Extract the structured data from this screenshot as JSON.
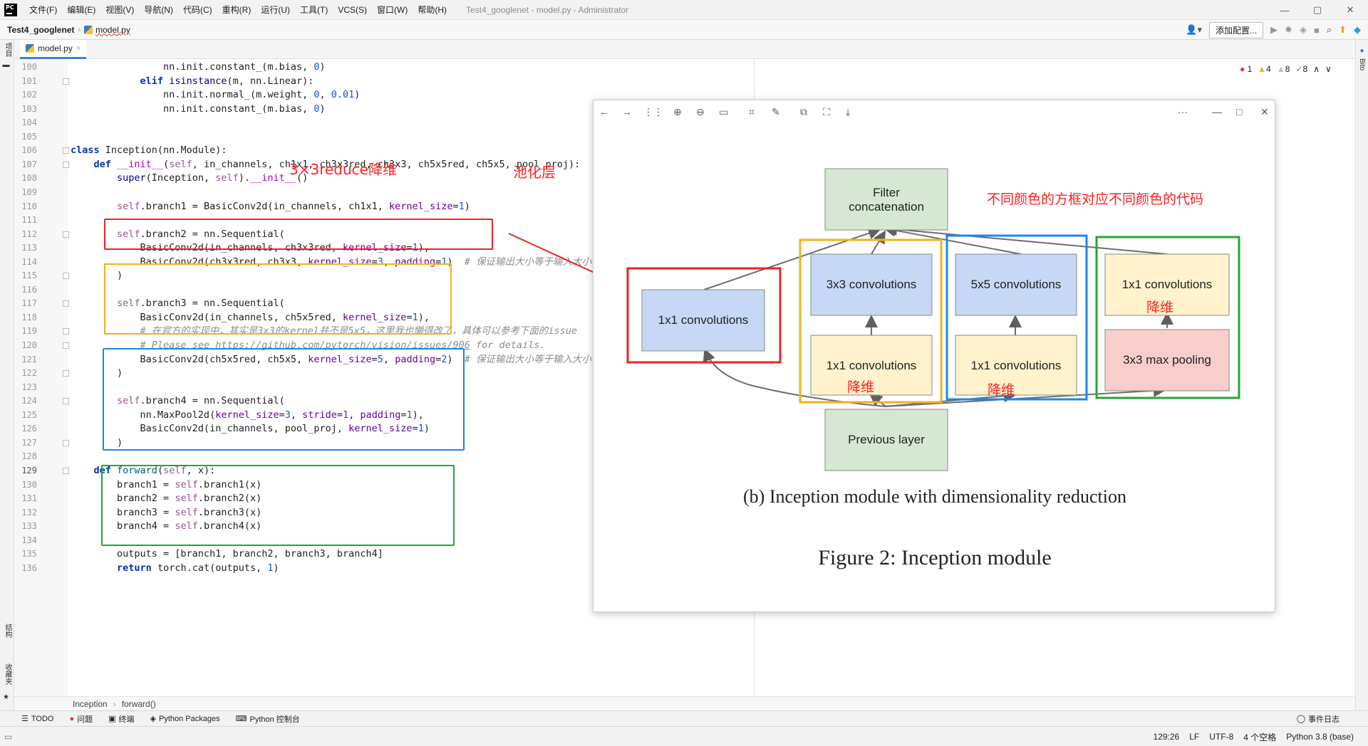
{
  "window": {
    "title": "Test4_googlenet - model.py - Administrator",
    "minimize": "—",
    "maximize": "▢",
    "close": "✕"
  },
  "menu": [
    "文件(F)",
    "编辑(E)",
    "视图(V)",
    "导航(N)",
    "代码(C)",
    "重构(R)",
    "运行(U)",
    "工具(T)",
    "VCS(S)",
    "窗口(W)",
    "帮助(H)"
  ],
  "nav": {
    "project": "Test4_googlenet",
    "file": "model.py",
    "add_config": "添加配置..."
  },
  "left_strip": {
    "project": "项目",
    "structure": "结构",
    "favorites": "收藏夹"
  },
  "right_strip": {
    "bito": "Bito"
  },
  "tab": {
    "label": "model.py",
    "close": "×"
  },
  "inspections": {
    "errors": "1",
    "warnings": "4",
    "weak": "8",
    "ok": "8"
  },
  "code": [
    {
      "n": "100",
      "segs": [
        [
          "t",
          "                nn.init.constant_(m.bias, "
        ],
        [
          "num",
          "0"
        ],
        [
          "t",
          ")"
        ]
      ]
    },
    {
      "n": "101",
      "segs": [
        [
          "t",
          "            "
        ],
        [
          "kw",
          "elif "
        ],
        [
          "bi",
          "isinstance"
        ],
        [
          "t",
          "(m, nn.Linear):"
        ]
      ]
    },
    {
      "n": "102",
      "segs": [
        [
          "t",
          "                nn.init.normal_(m.weight, "
        ],
        [
          "num",
          "0"
        ],
        [
          "t",
          ", "
        ],
        [
          "num",
          "0.01"
        ],
        [
          "t",
          ")"
        ]
      ]
    },
    {
      "n": "103",
      "segs": [
        [
          "t",
          "                nn.init.constant_(m.bias, "
        ],
        [
          "num",
          "0"
        ],
        [
          "t",
          ")"
        ]
      ]
    },
    {
      "n": "104",
      "segs": []
    },
    {
      "n": "105",
      "segs": []
    },
    {
      "n": "106",
      "segs": [
        [
          "kw",
          "class "
        ],
        [
          "t",
          "Inception(nn.Module):"
        ]
      ]
    },
    {
      "n": "107",
      "segs": [
        [
          "t",
          "    "
        ],
        [
          "kw",
          "def "
        ],
        [
          "fn",
          "__init__"
        ],
        [
          "t",
          "("
        ],
        [
          "self",
          "self"
        ],
        [
          "t",
          ", in_channels, ch1x1, ch3x3red, ch3x3, ch5x5red, ch5x5, pool_proj):"
        ]
      ]
    },
    {
      "n": "108",
      "segs": [
        [
          "t",
          "        "
        ],
        [
          "bi",
          "super"
        ],
        [
          "t",
          "(Inception, "
        ],
        [
          "self",
          "self"
        ],
        [
          "t",
          ")."
        ],
        [
          "fn",
          "__init__"
        ],
        [
          "t",
          "()"
        ]
      ]
    },
    {
      "n": "109",
      "segs": []
    },
    {
      "n": "110",
      "segs": [
        [
          "t",
          "        "
        ],
        [
          "self",
          "self"
        ],
        [
          "t",
          ".branch1 = BasicConv2d(in_channels, ch1x1, "
        ],
        [
          "kwa",
          "kernel_size"
        ],
        [
          "t",
          "="
        ],
        [
          "num",
          "1"
        ],
        [
          "t",
          ")"
        ]
      ]
    },
    {
      "n": "111",
      "segs": []
    },
    {
      "n": "112",
      "segs": [
        [
          "t",
          "        "
        ],
        [
          "self",
          "self"
        ],
        [
          "t",
          ".branch2 = nn.Sequential("
        ]
      ]
    },
    {
      "n": "113",
      "segs": [
        [
          "t",
          "            BasicConv2d(in_channels, ch3x3red, "
        ],
        [
          "kwa",
          "kernel_size"
        ],
        [
          "t",
          "="
        ],
        [
          "num",
          "1"
        ],
        [
          "t",
          "),"
        ]
      ]
    },
    {
      "n": "114",
      "segs": [
        [
          "t",
          "            BasicConv2d(ch3x3red, ch3x3, "
        ],
        [
          "kwa",
          "kernel_size"
        ],
        [
          "t",
          "="
        ],
        [
          "num",
          "3"
        ],
        [
          "t",
          ", "
        ],
        [
          "kwa",
          "padding"
        ],
        [
          "t",
          "="
        ],
        [
          "num",
          "1"
        ],
        [
          "t",
          ")  "
        ],
        [
          "cm",
          "# 保证输出大小等于输入大小"
        ]
      ]
    },
    {
      "n": "115",
      "segs": [
        [
          "t",
          "        )"
        ]
      ]
    },
    {
      "n": "116",
      "segs": []
    },
    {
      "n": "117",
      "segs": [
        [
          "t",
          "        "
        ],
        [
          "self",
          "self"
        ],
        [
          "t",
          ".branch3 = nn.Sequential("
        ]
      ]
    },
    {
      "n": "118",
      "segs": [
        [
          "t",
          "            BasicConv2d(in_channels, ch5x5red, "
        ],
        [
          "kwa",
          "kernel_size"
        ],
        [
          "t",
          "="
        ],
        [
          "num",
          "1"
        ],
        [
          "t",
          "),"
        ]
      ]
    },
    {
      "n": "119",
      "segs": [
        [
          "t",
          "            "
        ],
        [
          "cm",
          "# 在官方的实现中，其实是3x3的kernel并不是5x5，这里我也懒得改了，具体可以参考下面的issue"
        ]
      ]
    },
    {
      "n": "120",
      "segs": [
        [
          "t",
          "            "
        ],
        [
          "cm",
          "# Please see "
        ],
        [
          "lnk",
          "https://github.com/pytorch/vision/issues/906"
        ],
        [
          "cm",
          " for details."
        ]
      ]
    },
    {
      "n": "121",
      "segs": [
        [
          "t",
          "            BasicConv2d(ch5x5red, ch5x5, "
        ],
        [
          "kwa",
          "kernel_size"
        ],
        [
          "t",
          "="
        ],
        [
          "num",
          "5"
        ],
        [
          "t",
          ", "
        ],
        [
          "kwa",
          "padding"
        ],
        [
          "t",
          "="
        ],
        [
          "num",
          "2"
        ],
        [
          "t",
          ")  "
        ],
        [
          "cm",
          "# 保证输出大小等于输入大小"
        ]
      ]
    },
    {
      "n": "122",
      "segs": [
        [
          "t",
          "        )"
        ]
      ]
    },
    {
      "n": "123",
      "segs": []
    },
    {
      "n": "124",
      "segs": [
        [
          "t",
          "        "
        ],
        [
          "self",
          "self"
        ],
        [
          "t",
          ".branch4 = nn.Sequential("
        ]
      ]
    },
    {
      "n": "125",
      "segs": [
        [
          "t",
          "            nn.MaxPool2d("
        ],
        [
          "kwa",
          "kernel_size"
        ],
        [
          "t",
          "="
        ],
        [
          "num",
          "3"
        ],
        [
          "t",
          ", "
        ],
        [
          "kwa",
          "stride"
        ],
        [
          "t",
          "="
        ],
        [
          "num",
          "1"
        ],
        [
          "t",
          ", "
        ],
        [
          "kwa",
          "padding"
        ],
        [
          "t",
          "="
        ],
        [
          "num",
          "1"
        ],
        [
          "t",
          "),"
        ]
      ]
    },
    {
      "n": "126",
      "segs": [
        [
          "t",
          "            BasicConv2d(in_channels, pool_proj, "
        ],
        [
          "kwa",
          "kernel_size"
        ],
        [
          "t",
          "="
        ],
        [
          "num",
          "1"
        ],
        [
          "t",
          ")"
        ]
      ]
    },
    {
      "n": "127",
      "segs": [
        [
          "t",
          "        )"
        ]
      ]
    },
    {
      "n": "128",
      "segs": []
    },
    {
      "n": "129",
      "segs": [
        [
          "t",
          "    "
        ],
        [
          "kw",
          "def "
        ],
        [
          "fnd",
          "forward"
        ],
        [
          "t",
          "("
        ],
        [
          "self",
          "self"
        ],
        [
          "t",
          ", x):"
        ]
      ]
    },
    {
      "n": "130",
      "segs": [
        [
          "t",
          "        branch1 = "
        ],
        [
          "self",
          "self"
        ],
        [
          "t",
          ".branch1(x)"
        ]
      ]
    },
    {
      "n": "131",
      "segs": [
        [
          "t",
          "        branch2 = "
        ],
        [
          "self",
          "self"
        ],
        [
          "t",
          ".branch2(x)"
        ]
      ]
    },
    {
      "n": "132",
      "segs": [
        [
          "t",
          "        branch3 = "
        ],
        [
          "self",
          "self"
        ],
        [
          "t",
          ".branch3(x)"
        ]
      ]
    },
    {
      "n": "133",
      "segs": [
        [
          "t",
          "        branch4 = "
        ],
        [
          "self",
          "self"
        ],
        [
          "t",
          ".branch4(x)"
        ]
      ]
    },
    {
      "n": "134",
      "segs": []
    },
    {
      "n": "135",
      "segs": [
        [
          "t",
          "        outputs = [branch1, branch2, branch3, branch4]"
        ]
      ]
    },
    {
      "n": "136",
      "segs": [
        [
          "t",
          "        "
        ],
        [
          "kw",
          "return "
        ],
        [
          "t",
          "torch.cat(outputs, "
        ],
        [
          "num",
          "1"
        ],
        [
          "t",
          ")"
        ]
      ]
    }
  ],
  "annotations": {
    "reduce": "3×3reduce降维",
    "pool": "池化层",
    "colors_note": "不同颜色的方框对应不同颜色的代码",
    "reduce_tag": "降维"
  },
  "colors": {
    "red": "#ee2222",
    "orange": "#f5b01e",
    "blue": "#1e88e5",
    "green": "#1fa832",
    "keyword": "#0033b3",
    "self": "#94558d",
    "number": "#1750eb",
    "comment": "#8c8c8c",
    "kwarg": "#660099",
    "builtin": "#000080"
  },
  "viewer": {
    "more": "···",
    "minimize": "—",
    "maximize": "□",
    "close": "✕",
    "diagram": {
      "filter_concat": [
        "Filter",
        "concatenation"
      ],
      "conv3x3": "3x3 convolutions",
      "conv5x5": "5x5 convolutions",
      "conv1x1": "1x1 convolutions",
      "maxpool": "3x3 max pooling",
      "previous": "Previous layer",
      "subcaption": "(b)  Inception module with dimensionality reduction",
      "caption": "Figure 2: Inception module"
    }
  },
  "breadcrumb": {
    "cls": "Inception",
    "sep": "›",
    "fn": "forward()"
  },
  "toolwindows": [
    "TODO",
    "问题",
    "终端",
    "Python Packages",
    "Python 控制台"
  ],
  "event_log": "事件日志",
  "status": {
    "pos": "129:26",
    "eol": "LF",
    "enc": "UTF-8",
    "indent": "4 个空格",
    "interpreter": "Python 3.8 (base)"
  }
}
